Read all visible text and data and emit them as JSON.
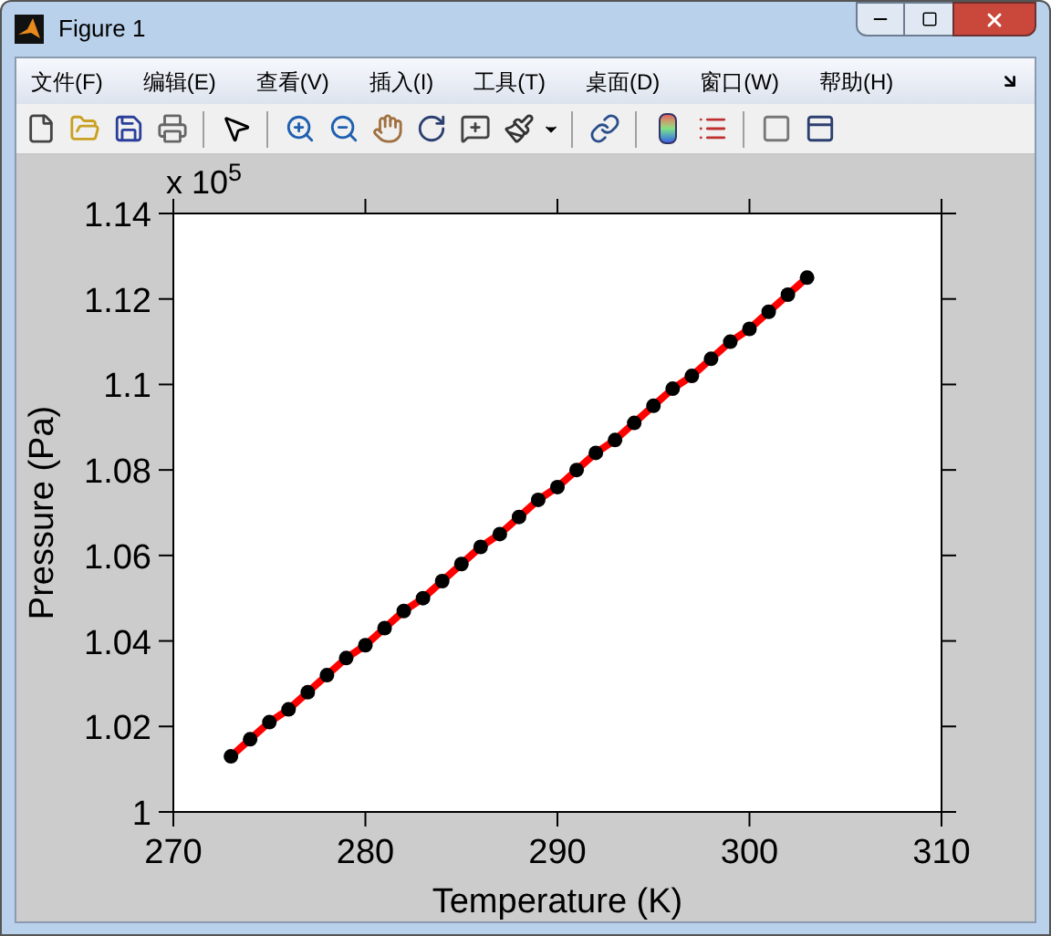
{
  "window": {
    "title": "Figure 1"
  },
  "menu": [
    "文件(F)",
    "编辑(E)",
    "查看(V)",
    "插入(I)",
    "工具(T)",
    "桌面(D)",
    "窗口(W)",
    "帮助(H)"
  ],
  "figure": {
    "y_multiplier": "x 10$^{5}$",
    "chart_data": {
      "type": "line",
      "xlabel": "Temperature (K)",
      "ylabel": "Pressure (Pa)",
      "xlim": [
        270,
        310
      ],
      "ylim": [
        1,
        1.14
      ],
      "xticks": [
        270,
        280,
        290,
        300,
        310
      ],
      "yticks": [
        1,
        1.02,
        1.04,
        1.06,
        1.08,
        1.1,
        1.12,
        1.14
      ],
      "x": [
        273,
        274,
        275,
        276,
        277,
        278,
        279,
        280,
        281,
        282,
        283,
        284,
        285,
        286,
        287,
        288,
        289,
        290,
        291,
        292,
        293,
        294,
        295,
        296,
        297,
        298,
        299,
        300,
        301,
        302,
        303
      ],
      "series": [
        {
          "color": "#ff0000",
          "marker": "o",
          "values": [
            1.013,
            1.017,
            1.021,
            1.024,
            1.028,
            1.032,
            1.036,
            1.039,
            1.043,
            1.047,
            1.05,
            1.054,
            1.058,
            1.062,
            1.065,
            1.069,
            1.073,
            1.076,
            1.08,
            1.084,
            1.087,
            1.091,
            1.095,
            1.099,
            1.102,
            1.106,
            1.11,
            1.113,
            1.117,
            1.121,
            1.125
          ]
        }
      ]
    }
  }
}
